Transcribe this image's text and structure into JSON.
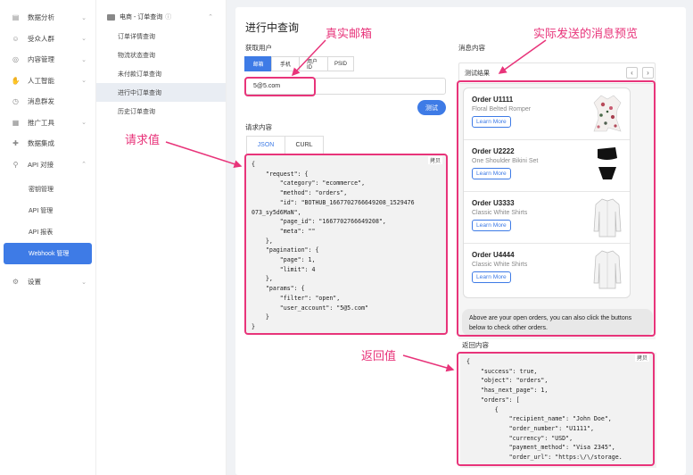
{
  "sidebar": {
    "items": [
      {
        "label": "数据分析",
        "icon": "chart-icon"
      },
      {
        "label": "受众人群",
        "icon": "people-icon"
      },
      {
        "label": "内容管理",
        "icon": "content-icon"
      },
      {
        "label": "人工智能",
        "icon": "ai-icon"
      },
      {
        "label": "消息群发",
        "icon": "clock-icon"
      },
      {
        "label": "推广工具",
        "icon": "grid-icon"
      },
      {
        "label": "数据集成",
        "icon": "puzzle-icon"
      },
      {
        "label": "API 对接",
        "icon": "api-icon"
      }
    ],
    "api_sub": [
      "密钥管理",
      "API 管理",
      "API 报表",
      "Webhook 管理"
    ],
    "settings": "设置"
  },
  "col2": {
    "header": "电商 - 订单查询",
    "items": [
      "订单详情查询",
      "物流状态查询",
      "未付款订单查询",
      "进行中订单查询",
      "历史订单查询"
    ]
  },
  "main": {
    "title": "进行中查询",
    "fetch_user_label": "获取用户",
    "tabs": [
      "邮箱",
      "手机",
      "用户 ID",
      "PSID"
    ],
    "email_value": "5@5.com",
    "test_button": "测试",
    "request_label": "请求内容",
    "request_tabs": [
      "JSON",
      "CURL"
    ],
    "copy": "拷贝",
    "request_json": "{\n    \"request\": {\n        \"category\": \"ecommerce\",\n        \"method\": \"orders\",\n        \"id\": \"BOTHUB_1667702766649208_1529476\n073_sy5d6MaN\",\n        \"page_id\": \"1667702766649208\",\n        \"meta\": \"\"\n    },\n    \"pagination\": {\n        \"page\": 1,\n        \"limit\": 4\n    },\n    \"params\": {\n        \"filter\": \"open\",\n        \"user_account\": \"5@5.com\"\n    }\n}",
    "message_label": "消息内容",
    "preview_title": "测试结果",
    "orders": [
      {
        "number": "Order U1111",
        "product": "Floral Belted Romper",
        "button": "Learn More",
        "thumb": "romper-image"
      },
      {
        "number": "Order U2222",
        "product": "One Shoulder Bikini Set",
        "button": "Learn More",
        "thumb": "bikini-image"
      },
      {
        "number": "Order U3333",
        "product": "Classic White Shirts",
        "button": "Learn More",
        "thumb": "shirt-image"
      },
      {
        "number": "Order U4444",
        "product": "Classic White Shirts",
        "button": "Learn More",
        "thumb": "shirt-image"
      }
    ],
    "bubble_text": "Above are your open orders, you can also click the buttons below to check other orders.",
    "response_label": "返回内容",
    "response_json": "{\n    \"success\": true,\n    \"object\": \"orders\",\n    \"has_next_page\": 1,\n    \"orders\": [\n        {\n            \"recipient_name\": \"John Doe\",\n            \"order_number\": \"U1111\",\n            \"currency\": \"USD\",\n            \"payment_method\": \"Visa 2345\",\n            \"order_url\": \"https:\\/\\/storage."
  },
  "annotations": {
    "email": "真实邮箱",
    "preview": "实际发送的消息预览",
    "request": "请求值",
    "response": "返回值"
  },
  "colors": {
    "accent": "#3e7be6",
    "annotation": "#e8347a"
  }
}
